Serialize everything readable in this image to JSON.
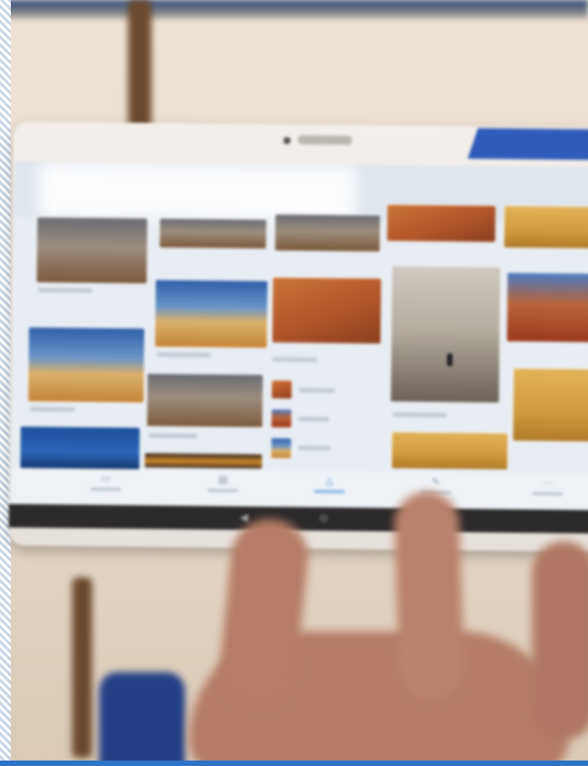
{
  "scene": {
    "description_type": "photo",
    "subject": "tablet",
    "app": "photo-gallery",
    "accent_color": "#3e86d6",
    "bezel_blue": "#2f5cb8"
  },
  "gallery": {
    "section_heading": "",
    "nav_items": [
      {
        "icon": "photo-icon",
        "glyph": "▭",
        "active": false
      },
      {
        "icon": "album-icon",
        "glyph": "▤",
        "active": false
      },
      {
        "icon": "map-icon",
        "glyph": "△",
        "active": true
      },
      {
        "icon": "edit-icon",
        "glyph": "✎",
        "active": false
      },
      {
        "icon": "more-icon",
        "glyph": "⋯",
        "active": false
      }
    ]
  },
  "softkeys": {
    "back": "◀",
    "home": "⊙"
  }
}
